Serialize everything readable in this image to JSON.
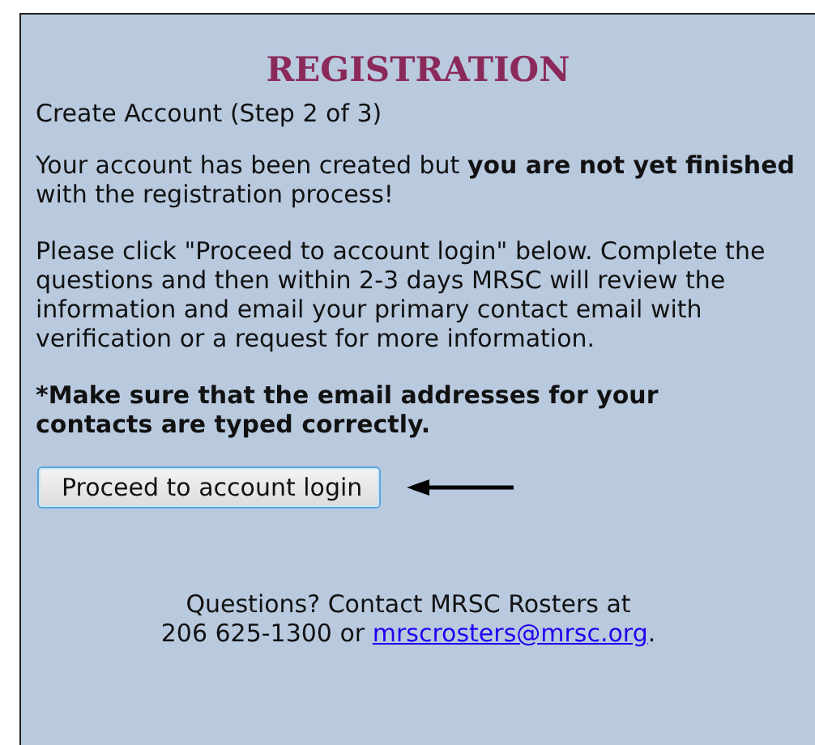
{
  "title": "REGISTRATION",
  "step": "Create Account (Step 2 of 3)",
  "paragraphs": [
    "Your account has been created but **you are not yet finished** with the registration process!",
    "Please click \"Proceed to account login\" below. Complete the questions and then within 2-3 days MRSC will review the information and email your primary contact email with verification or a request for more information."
  ],
  "notice": "*Make sure that the email addresses for your contacts are typed correctly.",
  "button": "Proceed to account login",
  "contact": {
    "line_1": "Questions? Contact MRSC Rosters at",
    "line_2": "206 625-1300 or",
    "email": "mrscrosters@mrsc.org",
    "end": "."
  }
}
